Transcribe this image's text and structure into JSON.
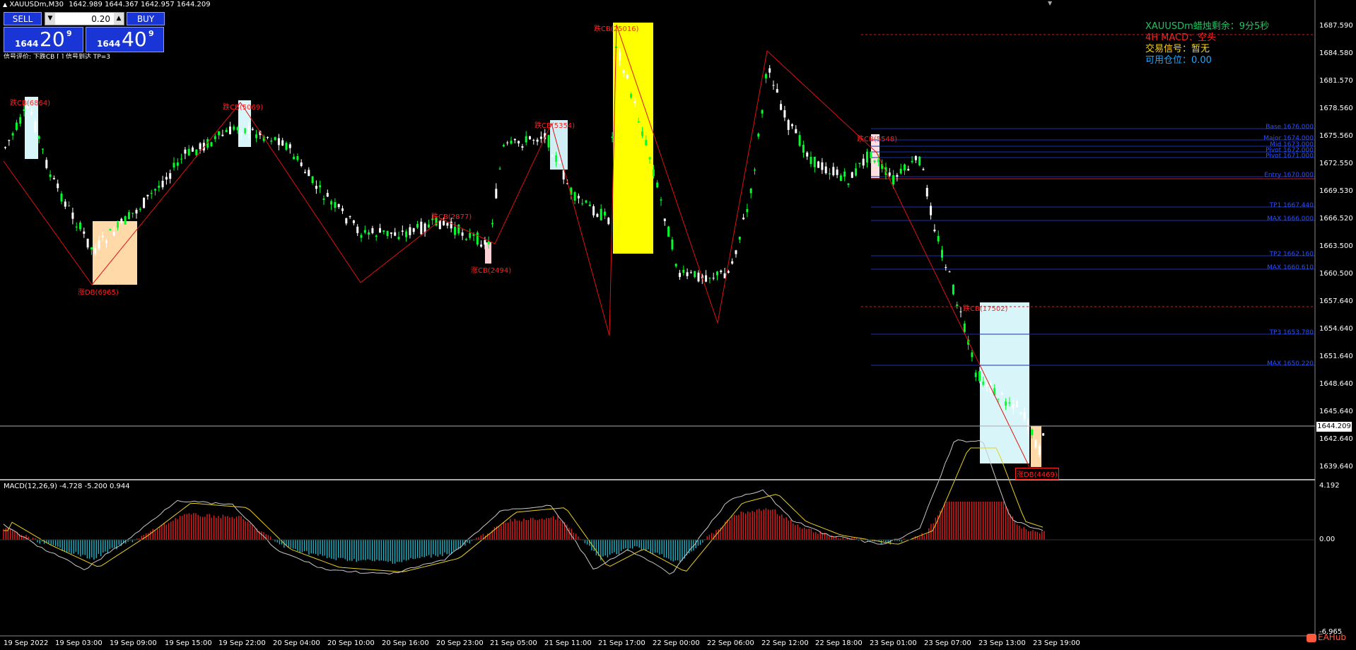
{
  "window": {
    "title": "XAUUSDm,M30",
    "ohlc": "1642.989 1644.367 1642.957 1644.209"
  },
  "trade_panel": {
    "sell_label": "SELL",
    "buy_label": "BUY",
    "lot_value": "0.20",
    "down_glyph": "▼",
    "up_glyph": "▲",
    "sell_price": {
      "prefix": "1644",
      "big": "20",
      "sup": "9"
    },
    "buy_price": {
      "prefix": "1644",
      "big": "40",
      "sup": "9"
    }
  },
  "signal_line": "信号评价:  下跌CB [ ] 信号到达 TP=3",
  "info": {
    "timer": "XAUUSDm蜡烛剩余：9分5秒",
    "macd4h": "4H MACD：空头",
    "signal": "交易信号：暂无",
    "position": "可用仓位：0.00",
    "colors": {
      "timer": "#22c55e",
      "macd4h": "#ff2020",
      "signal": "#ffd60a",
      "position": "#1ea7ff"
    }
  },
  "price_axis": {
    "labels": [
      "1687.590",
      "1684.580",
      "1681.570",
      "1678.560",
      "1675.560",
      "1672.550",
      "1669.530",
      "1666.520",
      "1663.500",
      "1660.500",
      "1657.640",
      "1654.640",
      "1651.640",
      "1648.640",
      "1645.640",
      "1642.640",
      "1639.640"
    ],
    "current": "1644.209"
  },
  "time_axis": [
    "19 Sep 2022",
    "19 Sep 03:00",
    "19 Sep 09:00",
    "19 Sep 15:00",
    "19 Sep 22:00",
    "20 Sep 04:00",
    "20 Sep 10:00",
    "20 Sep 16:00",
    "20 Sep 23:00",
    "21 Sep 05:00",
    "21 Sep 11:00",
    "21 Sep 17:00",
    "22 Sep 00:00",
    "22 Sep 06:00",
    "22 Sep 12:00",
    "22 Sep 18:00",
    "23 Sep 01:00",
    "23 Sep 07:00",
    "23 Sep 13:00",
    "23 Sep 19:00"
  ],
  "macd": {
    "title": "MACD(12,26,9) -4.728 -5.200 0.944",
    "labels": [
      "4.192",
      "0.00",
      "-6.965"
    ]
  },
  "annotations": [
    {
      "text": "跌CB(6864)",
      "color": "#ff2020"
    },
    {
      "text": "涨DB(6965)",
      "color": "#ff2020"
    },
    {
      "text": "跌CB(5069)",
      "color": "#ff2020"
    },
    {
      "text": "跌CB(2877)",
      "color": "#ff2020"
    },
    {
      "text": "涨CB(2494)",
      "color": "#ff2020"
    },
    {
      "text": "跌CB(5354)",
      "color": "#ff2020"
    },
    {
      "text": "跌CB(25016)",
      "color": "#ff2020"
    },
    {
      "text": "跌CB(5548)",
      "color": "#ff2020"
    },
    {
      "text": "跌CB(17502)",
      "color": "#ff2020"
    },
    {
      "text": "涨DB(4469)",
      "color": "#ff2020"
    }
  ],
  "levels": [
    {
      "text": "Base 1676.000",
      "color": "#2b4fff"
    },
    {
      "text": "Major 1674.000",
      "color": "#2b4fff"
    },
    {
      "text": "Mid 1673.000",
      "color": "#2b4fff"
    },
    {
      "text": "Pivot 1672.000",
      "color": "#2b4fff"
    },
    {
      "text": "Pivot 1671.000",
      "color": "#2b4fff"
    },
    {
      "text": "Entry 1670.000",
      "color": "#2b4fff"
    },
    {
      "text": "TP1 1667.440",
      "color": "#2b4fff"
    },
    {
      "text": "MAX 1666.000",
      "color": "#2b4fff"
    },
    {
      "text": "TP2 1662.160",
      "color": "#2b4fff"
    },
    {
      "text": "MAX 1660.610",
      "color": "#2b4fff"
    },
    {
      "text": "TP3 1653.780",
      "color": "#2b4fff"
    },
    {
      "text": "MAX 1650.220",
      "color": "#2b4fff"
    }
  ],
  "watermark": "EAHub",
  "colors": {
    "bull": "#00ff2a",
    "bear": "#ffffff",
    "zigzag": "#e01010",
    "macd_pos": "#e02020",
    "macd_neg": "#1fb5c8",
    "signal_line": "#e8d020",
    "macd_line": "#c8c8c8"
  }
}
